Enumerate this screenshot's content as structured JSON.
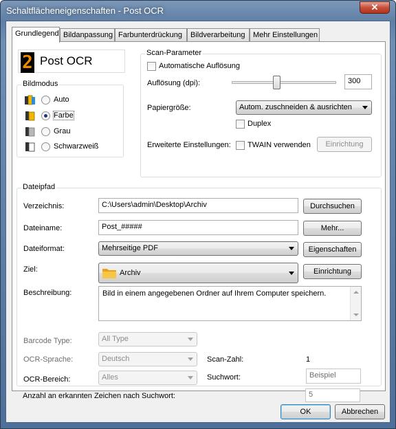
{
  "window": {
    "title": "Schaltflächeneigenschaften - Post OCR",
    "close_glyph": "✕"
  },
  "tabs": [
    {
      "label": "Grundlegend",
      "active": true
    },
    {
      "label": "Bildanpassung",
      "active": false
    },
    {
      "label": "Farbunterdrückung",
      "active": false
    },
    {
      "label": "Bildverarbeitung",
      "active": false
    },
    {
      "label": "Mehr Einstellungen",
      "active": false
    }
  ],
  "profile": {
    "digit": "2",
    "name": "Post OCR"
  },
  "bildmodus": {
    "title": "Bildmodus",
    "options": [
      {
        "label": "Auto",
        "checked": false
      },
      {
        "label": "Farbe",
        "checked": true
      },
      {
        "label": "Grau",
        "checked": false
      },
      {
        "label": "Schwarzweiß",
        "checked": false
      }
    ]
  },
  "scan": {
    "title": "Scan-Parameter",
    "auto_resolution_label": "Automatische Auflösung",
    "resolution_label": "Auflösung (dpi):",
    "resolution_value": "300",
    "paper_size_label": "Papiergröße:",
    "paper_size_value": "Autom. zuschneiden & ausrichten",
    "duplex_label": "Duplex",
    "advanced_label": "Erweiterte Einstellungen:",
    "twain_label": "TWAIN verwenden",
    "setup_button": "Einrichtung"
  },
  "dateipfad": {
    "title": "Dateipfad",
    "directory_label": "Verzeichnis:",
    "directory_value": "C:\\Users\\admin\\Desktop\\Archiv",
    "browse_button": "Durchsuchen",
    "filename_label": "Dateiname:",
    "filename_value": "Post_#####",
    "more_button": "Mehr...",
    "format_label": "Dateiformat:",
    "format_value": "Mehrseitige PDF",
    "properties_button": "Eigenschaften",
    "target_label": "Ziel:",
    "target_value": "Archiv",
    "target_setup_button": "Einrichtung",
    "description_label": "Beschreibung:",
    "description_value": "Bild in einem angegebenen Ordner auf Ihrem Computer speichern.",
    "barcode_label": "Barcode Type:",
    "barcode_value": "All Type",
    "ocr_lang_label": "OCR-Sprache:",
    "ocr_lang_value": "Deutsch",
    "ocr_area_label": "OCR-Bereich:",
    "ocr_area_value": "Alles",
    "scan_count_label": "Scan-Zahl:",
    "scan_count_value": "1",
    "search_word_label": "Suchwort:",
    "search_word_placeholder": "Beispiel",
    "char_count_label": "Anzahl an erkannten Zeichen nach Suchwort:",
    "char_count_value": "5"
  },
  "footer": {
    "ok_button": "OK",
    "cancel_button": "Abbrechen"
  },
  "colors": {
    "titlebar": "#6e8fb4",
    "close_button": "#c7503a",
    "digit_icon": "#f08a00",
    "default_button_border": "#3c7fb1"
  }
}
